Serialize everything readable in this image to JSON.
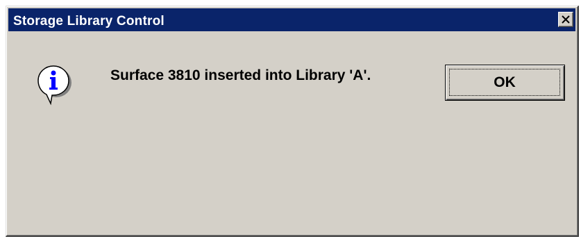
{
  "window": {
    "title": "Storage Library Control",
    "close_icon": "close-icon"
  },
  "dialog": {
    "icon": "info-icon",
    "message": "Surface 3810 inserted into Library 'A'.",
    "ok_label": "OK"
  },
  "colors": {
    "titlebar": "#0a246a",
    "title_text": "#ffffff",
    "dialog_face": "#d4d0c8",
    "icon_letter": "#0000ff"
  }
}
